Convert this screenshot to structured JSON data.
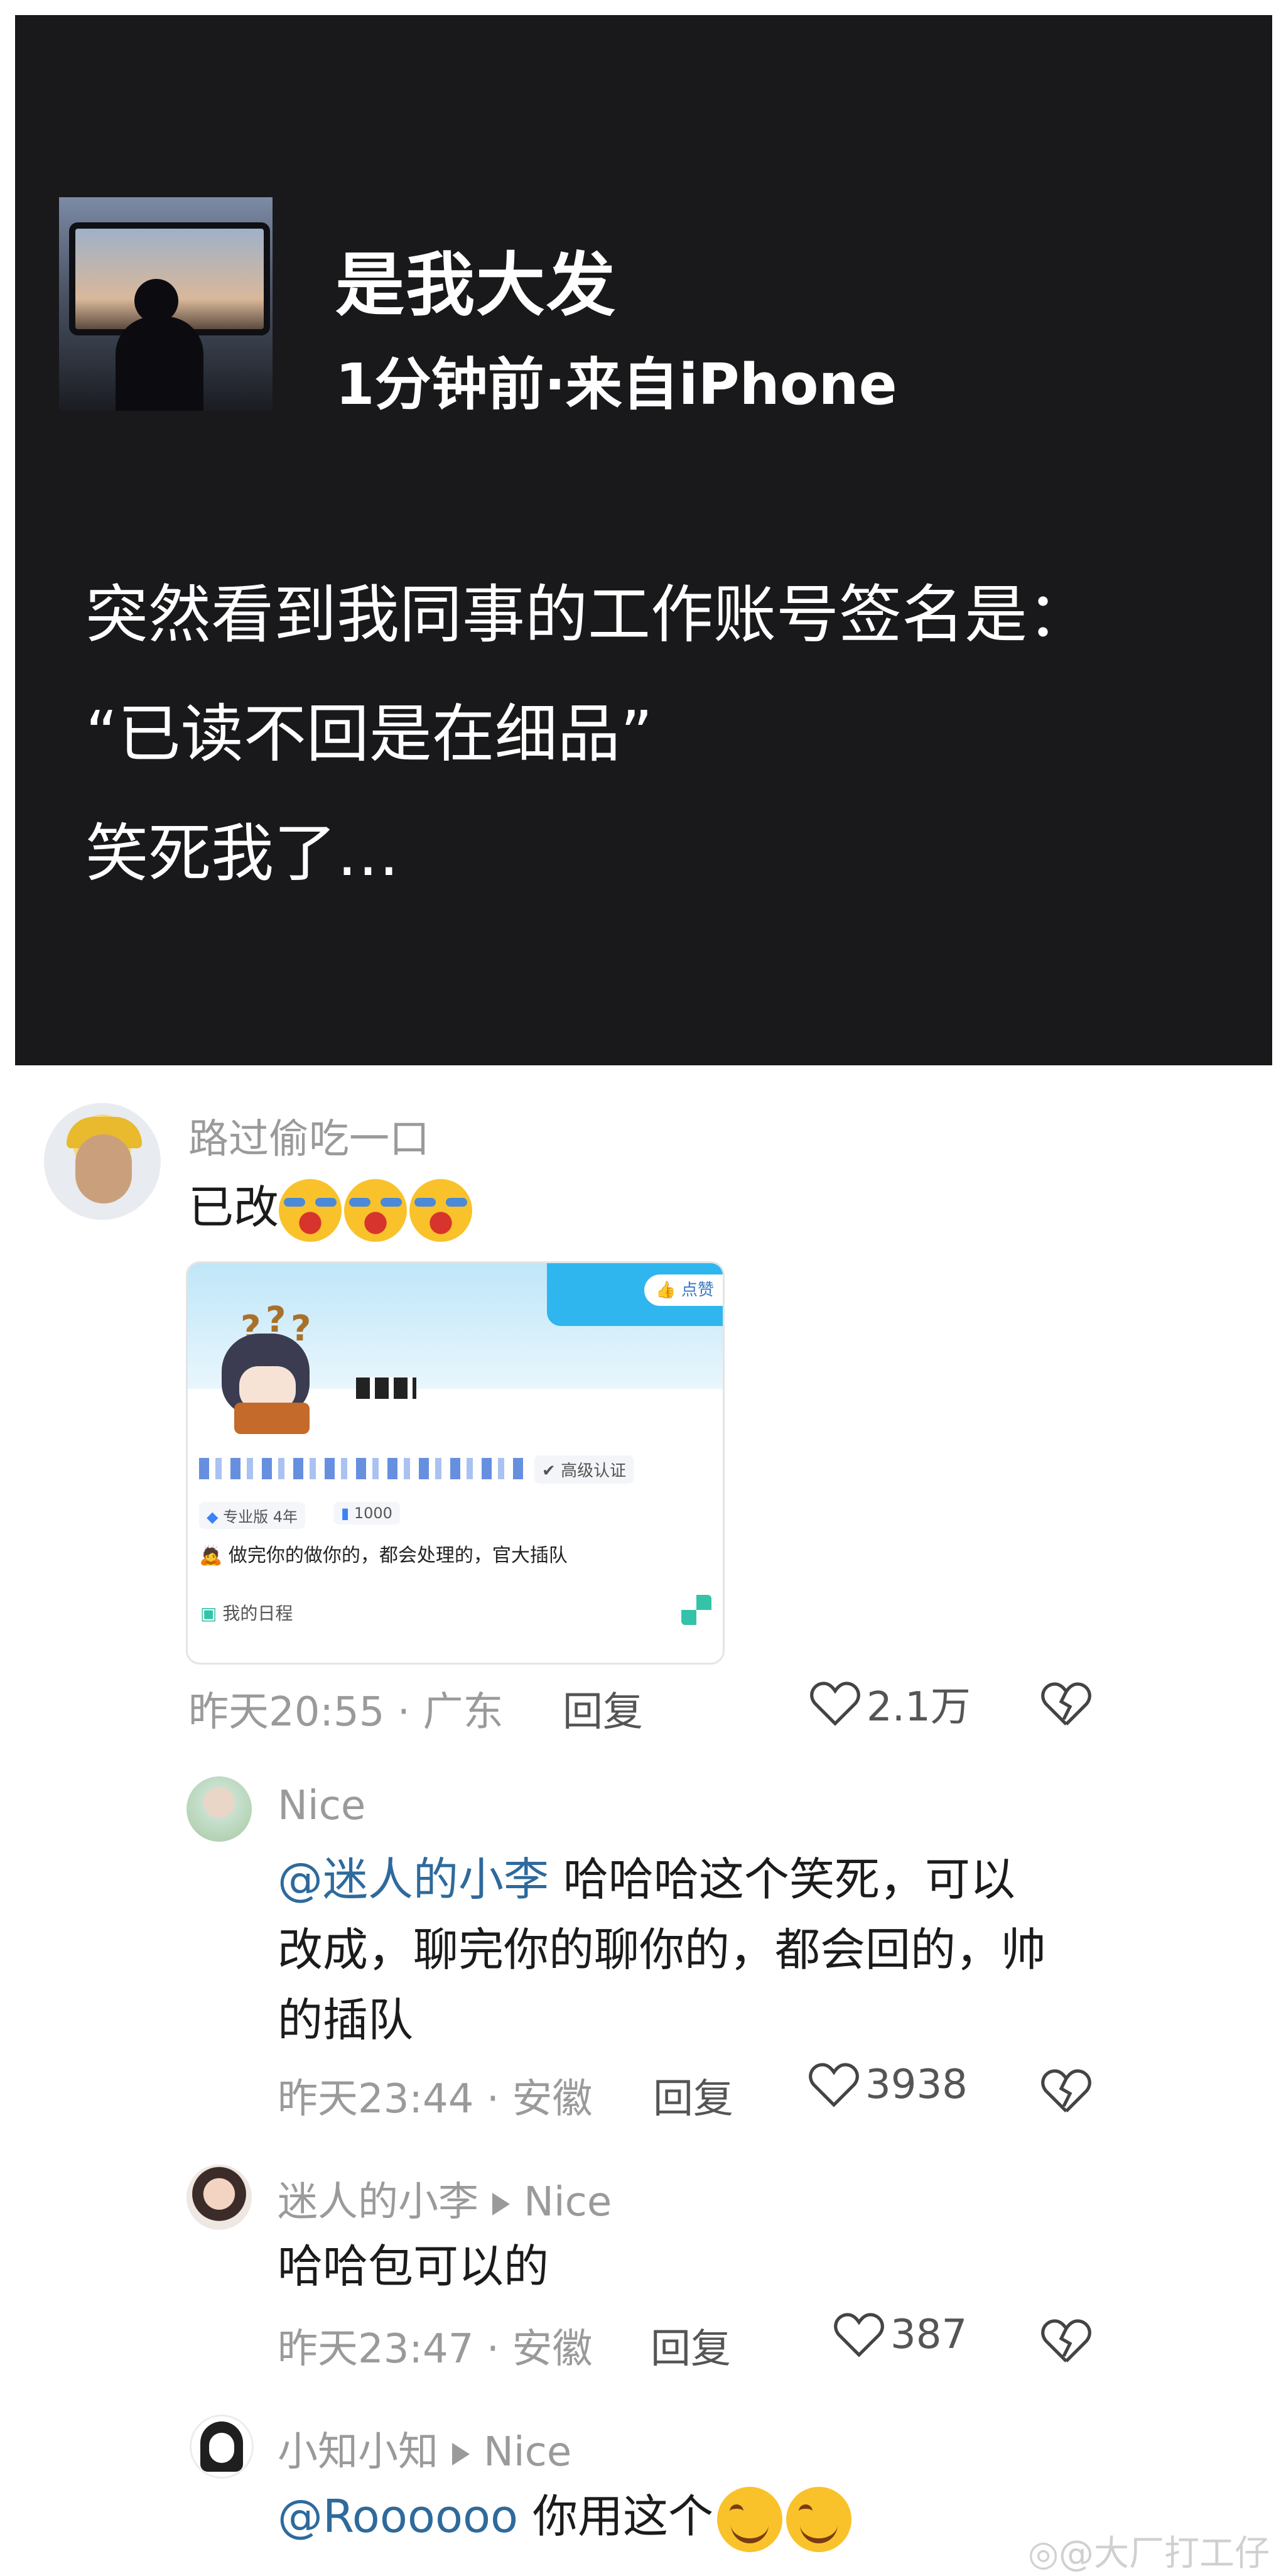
{
  "post": {
    "author": "是我大发",
    "meta": "1分钟前·来自iPhone",
    "lines": [
      "突然看到我同事的工作账号签名是：",
      "“已读不回是在细品”",
      "笑死我了…"
    ]
  },
  "comments": [
    {
      "name": "路过偷吃一口",
      "text": "已改",
      "emoji": "laugh-cry-emoji",
      "time": "昨天20:55 · 广东",
      "reply_label": "回复",
      "likes": "2.1万",
      "card": {
        "like_label": "点赞",
        "badge": "高级认证",
        "tag1": "专业版 4年",
        "tag2": "1000",
        "signature": "做完你的做你的，都会处理的，官大插队",
        "schedule": "我的日程"
      }
    },
    {
      "name": "Nice",
      "mention": "@迷人的小李",
      "text_line1": " 哈哈哈这个笑死，可以",
      "text_line2": "改成，聊完你的聊你的，都会回的，帅",
      "text_line3": "的插队",
      "time": "昨天23:44 · 安徽",
      "reply_label": "回复",
      "likes": "3938"
    },
    {
      "name": "迷人的小李",
      "reply_to": "Nice",
      "text": "哈哈包可以的",
      "time": "昨天23:47 · 安徽",
      "reply_label": "回复",
      "likes": "387"
    },
    {
      "name": "小知小知",
      "reply_to": "Nice",
      "mention": "@Roooooo",
      "text": " 你用这个",
      "emoji": "smile-emoji"
    }
  ],
  "watermark": "@大厂打工仔"
}
